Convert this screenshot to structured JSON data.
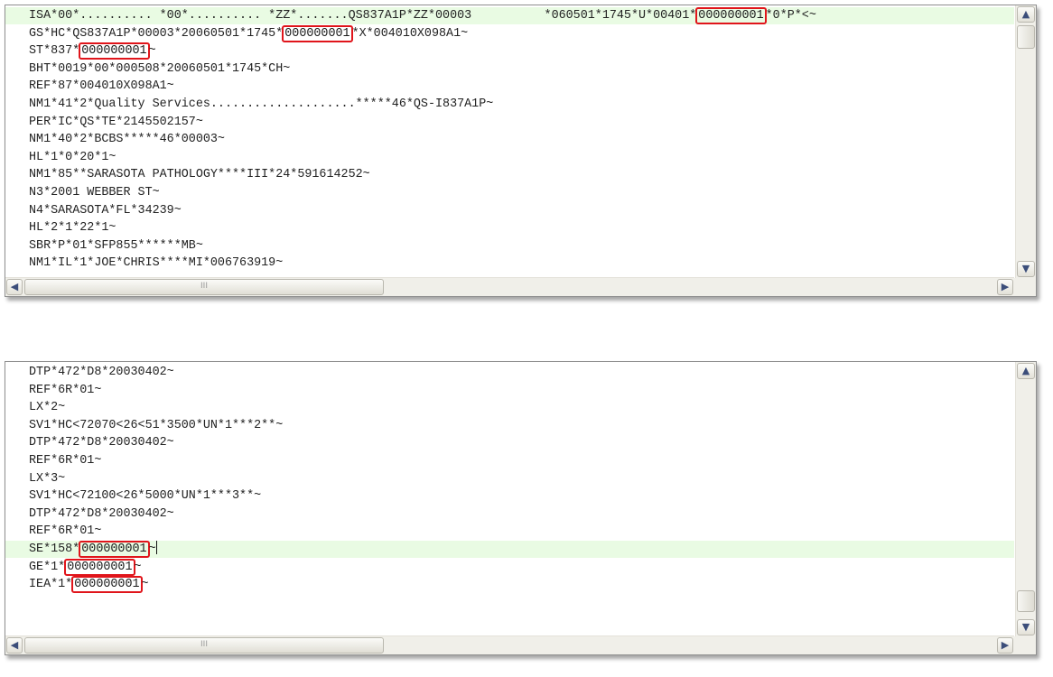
{
  "top_editor": {
    "lines": [
      {
        "text": "ISA*00*.......... *00*.......... *ZZ*.......QS837A1P*ZZ*00003          *060501*1745*U*00401*",
        "mark": "000000001",
        "after": "*0*P*<~",
        "hl": true
      },
      {
        "text": "GS*HC*QS837A1P*00003*20060501*1745*",
        "mark": "000000001",
        "after": "*X*004010X098A1~"
      },
      {
        "text": "ST*837*",
        "mark": "000000001",
        "after": "~"
      },
      {
        "text": "BHT*0019*00*000508*20060501*1745*CH~"
      },
      {
        "text": "REF*87*004010X098A1~"
      },
      {
        "text": "NM1*41*2*Quality Services....................*****46*QS-I837A1P~"
      },
      {
        "text": "PER*IC*QS*TE*2145502157~"
      },
      {
        "text": "NM1*40*2*BCBS*****46*00003~"
      },
      {
        "text": "HL*1*0*20*1~"
      },
      {
        "text": "NM1*85**SARASOTA PATHOLOGY****III*24*591614252~"
      },
      {
        "text": "N3*2001 WEBBER ST~"
      },
      {
        "text": "N4*SARASOTA*FL*34239~"
      },
      {
        "text": "HL*2*1*22*1~"
      },
      {
        "text": "SBR*P*01*SFP855******MB~"
      },
      {
        "text": "NM1*IL*1*JOE*CHRIS****MI*006763919~"
      }
    ],
    "hscroll_label": "III"
  },
  "bottom_editor": {
    "lines": [
      {
        "text": "DTP*472*D8*20030402~"
      },
      {
        "text": "REF*6R*01~"
      },
      {
        "text": "LX*2~"
      },
      {
        "text": "SV1*HC<72070<26<51*3500*UN*1***2**~"
      },
      {
        "text": "DTP*472*D8*20030402~"
      },
      {
        "text": "REF*6R*01~"
      },
      {
        "text": "LX*3~"
      },
      {
        "text": "SV1*HC<72100<26*5000*UN*1***3**~"
      },
      {
        "text": "DTP*472*D8*20030402~"
      },
      {
        "text": "REF*6R*01~"
      },
      {
        "text": "SE*158*",
        "mark": "000000001",
        "after": "~",
        "hl": true,
        "caret": true
      },
      {
        "text": "GE*1*",
        "mark": "000000001",
        "after": "~"
      },
      {
        "text": "IEA*1*",
        "mark": "000000001",
        "after": "~"
      }
    ],
    "hscroll_label": "III"
  },
  "icons": {
    "scroll_up": "▲",
    "scroll_down": "▼",
    "scroll_left": "◀",
    "scroll_right": "▶"
  },
  "colors": {
    "highlight_box": "#e0151b",
    "current_line": "#e9fbe3"
  }
}
